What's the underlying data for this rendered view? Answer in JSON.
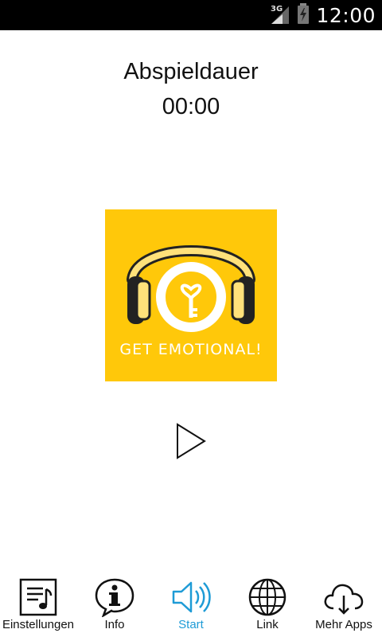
{
  "status_bar": {
    "network": "3G",
    "time": "12:00"
  },
  "player": {
    "title": "Abspieldauer",
    "elapsed": "00:00"
  },
  "cover": {
    "caption": "GET EMOTIONAL!",
    "background": "#ffc80a"
  },
  "tabs": [
    {
      "label": "Einstellungen",
      "icon": "settings-list-icon"
    },
    {
      "label": "Info",
      "icon": "info-bubble-icon"
    },
    {
      "label": "Start",
      "icon": "speaker-icon",
      "active": true
    },
    {
      "label": "Link",
      "icon": "globe-icon"
    },
    {
      "label": "Mehr Apps",
      "icon": "cloud-download-icon"
    }
  ],
  "colors": {
    "accent": "#1e9bd6",
    "status_bar": "#000000"
  }
}
